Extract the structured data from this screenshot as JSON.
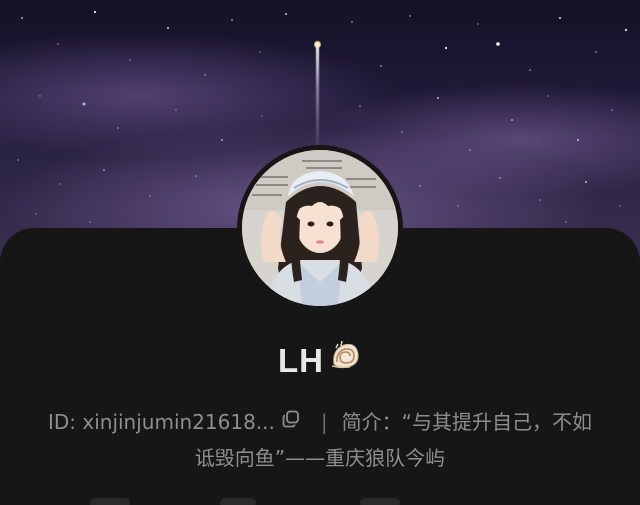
{
  "profile": {
    "name": "LH",
    "name_emoji": "spiral-shell-emoji",
    "id_label": "ID: xinjinjumin21618...",
    "separator": "|",
    "bio_label": "简介：",
    "bio_text": "“与其提升自己，不如诋毁向鱼”——重庆狼队今屿"
  },
  "banner": {
    "theme": "night sky with rocket trail",
    "colors": {
      "sky_top": "#141127",
      "sky_bottom": "#3a3052",
      "card_bg": "#161616",
      "text_primary": "#e8e8e8",
      "text_secondary": "#8e8e8e"
    }
  },
  "icons": {
    "copy": "copy-icon",
    "shell": "spiral-shell-icon"
  }
}
